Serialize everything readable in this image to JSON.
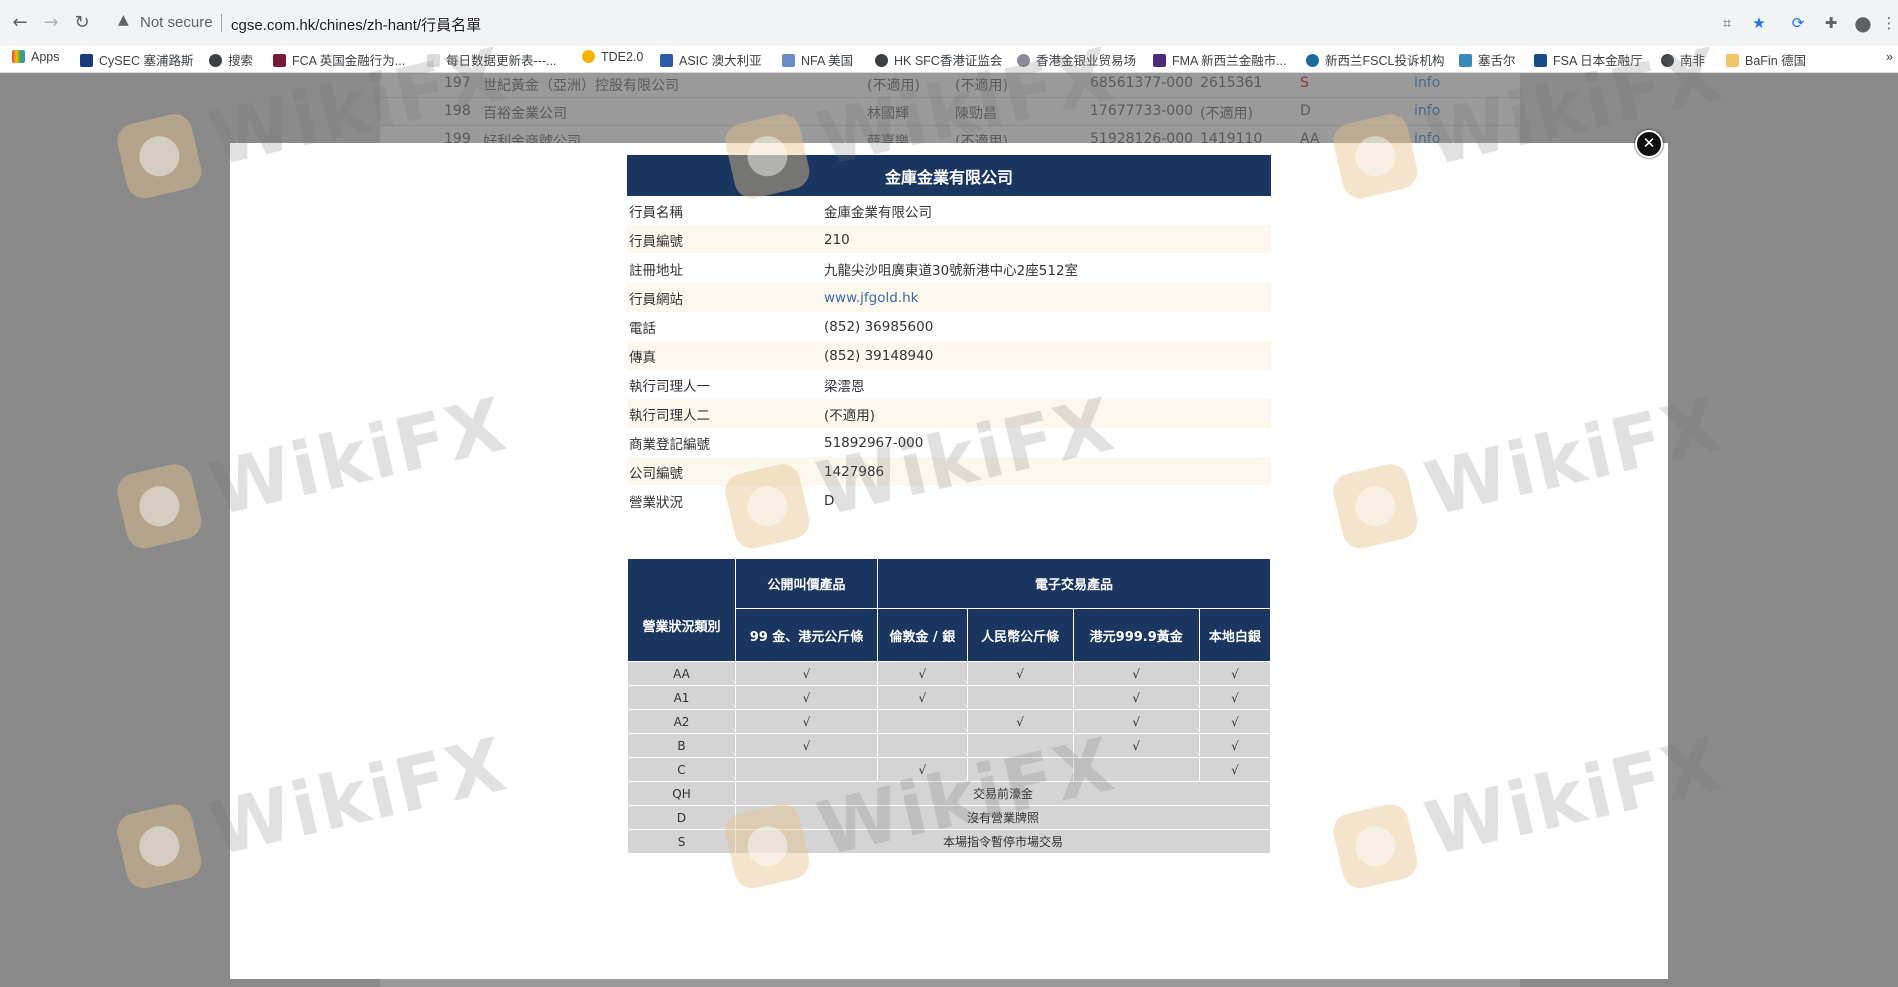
{
  "browser": {
    "security_label": "Not secure",
    "url": "cgse.com.hk/chines/zh-hant/行員名單",
    "bookmarks": [
      "Apps",
      "CySEC 塞浦路斯",
      "搜索",
      "FCA 英国金融行为...",
      "每日数据更新表---...",
      "TDE2.0",
      "ASIC 澳大利亚",
      "NFA 美国",
      "HK SFC香港证监会",
      "香港金银业贸易场",
      "FMA 新西兰金融市...",
      "新西兰FSCL投诉机构",
      "塞舌尔",
      "FSA 日本金融厅",
      "南非",
      "BaFin 德国"
    ],
    "more": "»"
  },
  "background_rows": [
    {
      "no": "197",
      "name": "世紀黃金（亞洲）控股有限公司",
      "p1": "(不適用)",
      "p2": "(不適用)",
      "reg": "68561377-000",
      "co": "2615361",
      "status": "S",
      "link": "info"
    },
    {
      "no": "198",
      "name": "百裕金業公司",
      "p1": "林國輝",
      "p2": "陳勁昌",
      "reg": "17677733-000",
      "co": "(不適用)",
      "status": "D",
      "link": "info"
    },
    {
      "no": "199",
      "name": "好利金商號公司",
      "p1": "薛嘉樂",
      "p2": "(不適用)",
      "reg": "51928126-000",
      "co": "1419110",
      "status": "AA",
      "link": "info"
    }
  ],
  "member": {
    "title": "金庫金業有限公司",
    "fields": [
      {
        "label": "行員名稱",
        "value": "金庫金業有限公司"
      },
      {
        "label": "行員編號",
        "value": "210"
      },
      {
        "label": "註冊地址",
        "value": "九龍尖沙咀廣東道30號新港中心2座512室"
      },
      {
        "label": "行員網站",
        "value": "www.jfgold.hk"
      },
      {
        "label": "電話",
        "value": "(852) 36985600"
      },
      {
        "label": "傳真",
        "value": "(852) 39148940"
      },
      {
        "label": "執行司理人一",
        "value": "梁澐恩"
      },
      {
        "label": "執行司理人二",
        "value": "(不適用)"
      },
      {
        "label": "商業登記編號",
        "value": "51892967-000"
      },
      {
        "label": "公司編號",
        "value": "1427986"
      },
      {
        "label": "營業狀況",
        "value": "D"
      }
    ]
  },
  "status_table": {
    "col_category": "營業狀況類別",
    "group_public": "公開叫價產品",
    "group_electronic": "電子交易產品",
    "columns": [
      "99 金、港元公斤條",
      "倫敦金 / 銀",
      "人民幣公斤條",
      "港元999.9黃金",
      "本地白銀"
    ],
    "rows": [
      {
        "code": "AA",
        "cells": [
          "√",
          "√",
          "√",
          "√",
          "√"
        ]
      },
      {
        "code": "A1",
        "cells": [
          "√",
          "√",
          "",
          "√",
          "√"
        ]
      },
      {
        "code": "A2",
        "cells": [
          "√",
          "",
          "√",
          "√",
          "√"
        ]
      },
      {
        "code": "B",
        "cells": [
          "√",
          "",
          "",
          "√",
          "√"
        ]
      },
      {
        "code": "C",
        "cells": [
          "",
          "√",
          "",
          "",
          "√"
        ]
      }
    ],
    "span_rows": [
      {
        "code": "QH",
        "text": "交易前濠金"
      },
      {
        "code": "D",
        "text": "沒有營業牌照"
      },
      {
        "code": "S",
        "text": "本場指令暫停市場交易"
      }
    ]
  },
  "watermark": "WikiFX"
}
